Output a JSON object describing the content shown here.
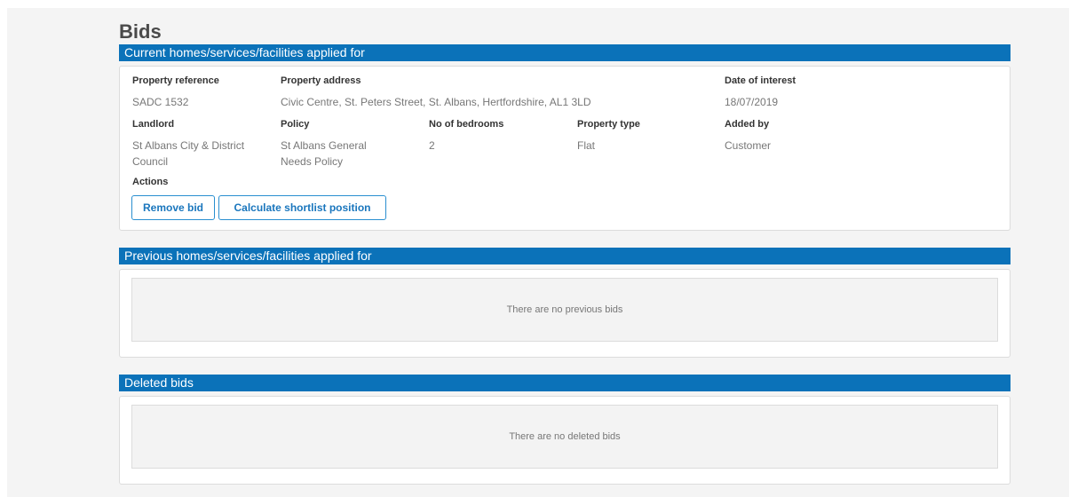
{
  "page": {
    "title": "Bids"
  },
  "current": {
    "header": "Current homes/services/facilities applied for",
    "labels": {
      "property_reference": "Property reference",
      "property_address": "Property address",
      "date_of_interest": "Date of interest",
      "landlord": "Landlord",
      "policy": "Policy",
      "no_of_bedrooms": "No of bedrooms",
      "property_type": "Property type",
      "added_by": "Added by",
      "actions": "Actions"
    },
    "values": {
      "property_reference": "SADC 1532",
      "property_address": "Civic Centre, St. Peters Street, St. Albans, Hertfordshire, AL1 3LD",
      "date_of_interest": "18/07/2019",
      "landlord": "St Albans City & District Council",
      "policy": "St Albans General Needs Policy",
      "no_of_bedrooms": "2",
      "property_type": "Flat",
      "added_by": "Customer"
    },
    "buttons": {
      "remove_bid": "Remove bid",
      "calculate_shortlist": "Calculate shortlist position"
    }
  },
  "previous": {
    "header": "Previous homes/services/facilities applied for",
    "empty_message": "There are no previous bids"
  },
  "deleted": {
    "header": "Deleted bids",
    "empty_message": "There are no deleted bids"
  },
  "colors": {
    "header_bar": "#0b72b9",
    "button_text": "#1a76bd",
    "background": "#f4f4f4"
  }
}
